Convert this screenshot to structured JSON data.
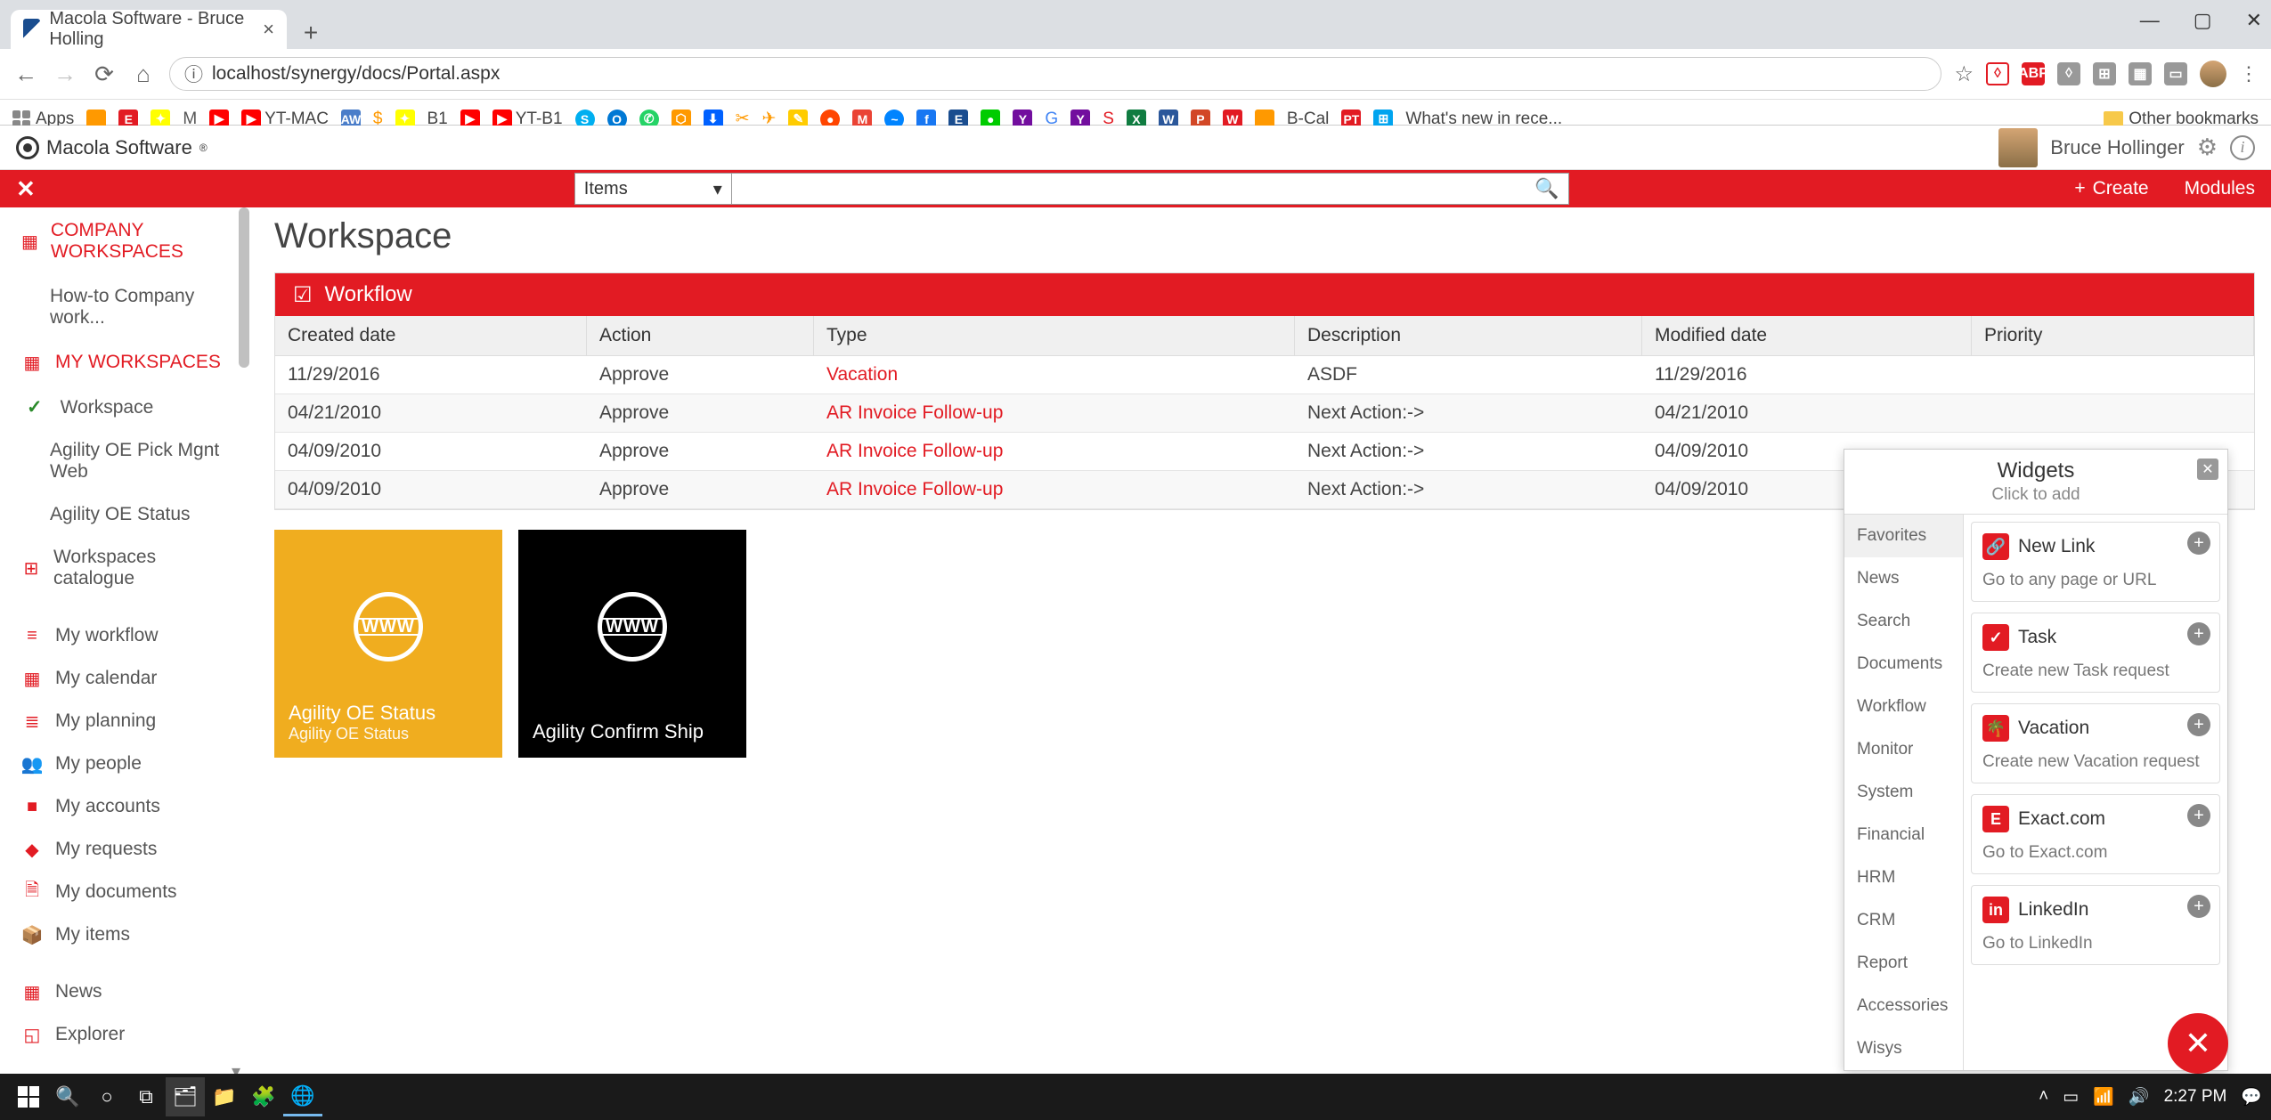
{
  "browser": {
    "tab_title": "Macola Software - Bruce Holling",
    "url_info_icon": "ⓘ",
    "url": "localhost/synergy/docs/Portal.aspx",
    "win_min": "—",
    "win_max": "▢",
    "win_close": "✕",
    "bookmarks": {
      "apps": "Apps",
      "items": [
        "O",
        "E",
        "Y",
        "M",
        "YT",
        "YT-MAC",
        "AW",
        "$",
        "Y",
        "B1",
        "YT",
        "YT-B1",
        "S",
        "O",
        "V",
        "M",
        "⬇",
        "S",
        "✈",
        "✎",
        "R",
        "M",
        "M",
        "F",
        "E",
        "O",
        "Y",
        "G",
        "Y",
        "S",
        "X",
        "W",
        "P",
        "W",
        "O",
        "B-Cal",
        "PT",
        "MS",
        "What's new in rece..."
      ],
      "other": "Other bookmarks"
    }
  },
  "app_header": {
    "logo": "Macola Software",
    "user": "Bruce Hollinger"
  },
  "red_bar": {
    "search_category": "Items",
    "create": "Create",
    "modules": "Modules"
  },
  "sidebar": {
    "company_ws": "COMPANY WORKSPACES",
    "howto": "How-to Company work...",
    "my_ws": "MY WORKSPACES",
    "items": [
      {
        "label": "Workspace",
        "active": true
      },
      {
        "label": "Agility OE Pick Mgnt Web"
      },
      {
        "label": "Agility OE Status"
      }
    ],
    "catalogue": "Workspaces catalogue",
    "links": [
      {
        "icon": "≡",
        "label": "My workflow"
      },
      {
        "icon": "▦",
        "label": "My calendar"
      },
      {
        "icon": "≣",
        "label": "My planning"
      },
      {
        "icon": "👥",
        "label": "My people"
      },
      {
        "icon": "■",
        "label": "My accounts"
      },
      {
        "icon": "◆",
        "label": "My requests"
      },
      {
        "icon": "🗎",
        "label": "My documents"
      },
      {
        "icon": "📦",
        "label": "My items"
      },
      {
        "icon": "▦",
        "label": "News"
      },
      {
        "icon": "◱",
        "label": "Explorer"
      }
    ]
  },
  "main": {
    "title": "Workspace",
    "workflow": {
      "header": "Workflow",
      "columns": [
        "Created date",
        "Action",
        "Type",
        "Description",
        "Modified date",
        "Priority"
      ],
      "rows": [
        {
          "created": "11/29/2016",
          "action": "Approve",
          "type": "Vacation",
          "desc": "ASDF",
          "modified": "11/29/2016"
        },
        {
          "created": "04/21/2010",
          "action": "Approve",
          "type": "AR Invoice Follow-up",
          "desc": "Next Action:->",
          "modified": "04/21/2010"
        },
        {
          "created": "04/09/2010",
          "action": "Approve",
          "type": "AR Invoice Follow-up",
          "desc": "Next Action:->",
          "modified": "04/09/2010"
        },
        {
          "created": "04/09/2010",
          "action": "Approve",
          "type": "AR Invoice Follow-up",
          "desc": "Next Action:->",
          "modified": "04/09/2010"
        }
      ]
    },
    "tiles": [
      {
        "title": "Agility OE Status",
        "sub": "Agility OE Status",
        "color": "yellow",
        "globe": "WWW"
      },
      {
        "title": "Agility Confirm Ship",
        "sub": "",
        "color": "black",
        "globe": "WWW"
      }
    ]
  },
  "widgets": {
    "title": "Widgets",
    "subtitle": "Click to add",
    "categories": [
      "Favorites",
      "News",
      "Search",
      "Documents",
      "Workflow",
      "Monitor",
      "System",
      "Financial",
      "HRM",
      "CRM",
      "Report",
      "Accessories",
      "Wisys"
    ],
    "items": [
      {
        "icon_bg": "#e21b23",
        "icon": "🔗",
        "title": "New Link",
        "desc": "Go to any page or URL"
      },
      {
        "icon_bg": "#e21b23",
        "icon": "✓",
        "title": "Task",
        "desc": "Create new Task request"
      },
      {
        "icon_bg": "#e21b23",
        "icon": "🌴",
        "title": "Vacation",
        "desc": "Create new Vacation request"
      },
      {
        "icon_bg": "#e21b23",
        "icon": "E",
        "title": "Exact.com",
        "desc": "Go to Exact.com"
      },
      {
        "icon_bg": "#e21b23",
        "icon": "in",
        "title": "LinkedIn",
        "desc": "Go to LinkedIn"
      }
    ]
  },
  "taskbar": {
    "time": "2:27 PM"
  }
}
